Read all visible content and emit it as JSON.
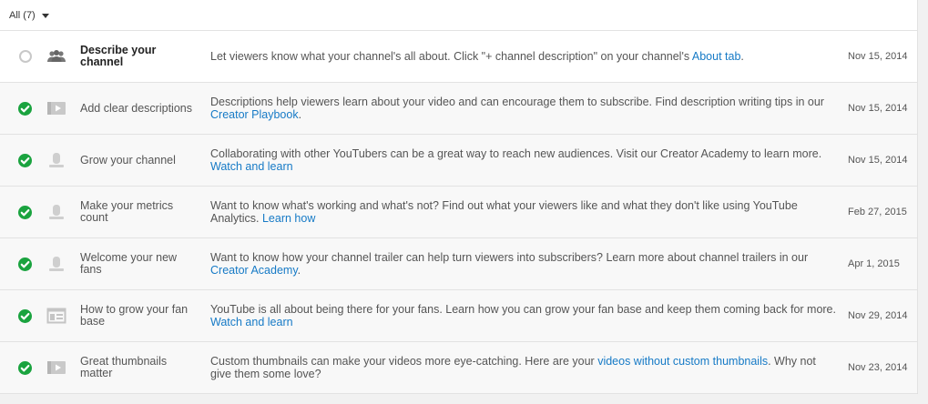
{
  "filter": {
    "label": "All (7)"
  },
  "rows": [
    {
      "status": "pending",
      "icon": "people-icon",
      "title_strong": true,
      "title": "Describe your channel",
      "desc_text": "Let viewers know what your channel's all about. Click \"+ channel description\" on your channel's ",
      "link": "About tab",
      "desc_after": ".",
      "date": "Nov 15, 2014"
    },
    {
      "status": "complete",
      "icon": "video-icon",
      "title_strong": false,
      "title": "Add clear descriptions",
      "desc_text": "Descriptions help viewers learn about your video and can encourage them to subscribe. Find description writing tips in our ",
      "link": "Creator Playbook",
      "desc_after": ".",
      "date": "Nov 15, 2014"
    },
    {
      "status": "complete",
      "icon": "person-icon",
      "title_strong": false,
      "title": "Grow your channel",
      "desc_text": "Collaborating with other YouTubers can be a great way to reach new audiences. Visit our Creator Academy to learn more. ",
      "link": "Watch and learn",
      "desc_after": "",
      "date": "Nov 15, 2014"
    },
    {
      "status": "complete",
      "icon": "person-icon",
      "title_strong": false,
      "title": "Make your metrics count",
      "desc_text": "Want to know what's working and what's not? Find out what your viewers like and what they don't like using YouTube Analytics. ",
      "link": "Learn how",
      "desc_after": "",
      "date": "Feb 27, 2015"
    },
    {
      "status": "complete",
      "icon": "person-icon",
      "title_strong": false,
      "title": "Welcome your new fans",
      "desc_text": "Want to know how your channel trailer can help turn viewers into subscribers? Learn more about channel trailers in our ",
      "link": "Creator Academy",
      "desc_after": ".",
      "date": "Apr 1, 2015"
    },
    {
      "status": "complete",
      "icon": "layout-icon",
      "title_strong": false,
      "title": "How to grow your fan base",
      "desc_text": "YouTube is all about being there for your fans. Learn how you can grow your fan base and keep them coming back for more. ",
      "link": "Watch and learn",
      "desc_after": "",
      "date": "Nov 29, 2014"
    },
    {
      "status": "complete",
      "icon": "video-icon",
      "title_strong": false,
      "title": "Great thumbnails matter",
      "desc_text": "Custom thumbnails can make your videos more eye-catching. Here are your ",
      "link": "videos without custom thumbnails",
      "desc_after": ". Why not give them some love?",
      "date": "Nov 23, 2014"
    }
  ]
}
